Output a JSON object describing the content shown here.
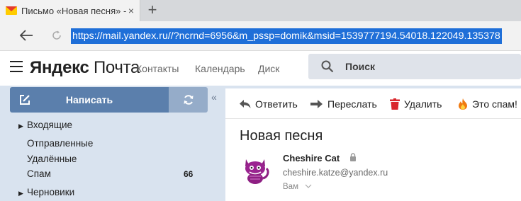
{
  "browser": {
    "tab_title": "Письмо «Новая песня» -",
    "close_glyph": "×",
    "newtab_glyph": "+",
    "url": "https://mail.yandex.ru//?ncrnd=6956&m_pssp=domik&msid=1539777194.54018.122049.135378"
  },
  "header": {
    "logo_brand": "Яндекс",
    "logo_product": "Почта",
    "nav": [
      "Контакты",
      "Календарь",
      "Диск"
    ],
    "search_placeholder": "Поиск"
  },
  "sidebar": {
    "compose_label": "Написать",
    "collapse_glyph": "«",
    "arrow_glyph": "▶",
    "folders": [
      {
        "label": "Входящие",
        "count": ""
      },
      {
        "label": "Отправленные",
        "count": ""
      },
      {
        "label": "Удалённые",
        "count": ""
      },
      {
        "label": "Спам",
        "count": "66"
      },
      {
        "label": "Черновики",
        "count": ""
      }
    ]
  },
  "toolbar": {
    "reply": "Ответить",
    "forward": "Переслать",
    "delete": "Удалить",
    "spam": "Это спам!"
  },
  "message": {
    "subject": "Новая песня",
    "sender_name": "Cheshire Cat",
    "sender_email": "cheshire.katze@yandex.ru",
    "to": "Вам"
  },
  "colors": {
    "accent_blue": "#5b7fac",
    "panel_bg": "#d9e3ef",
    "url_highlight": "#1f6fd8"
  }
}
